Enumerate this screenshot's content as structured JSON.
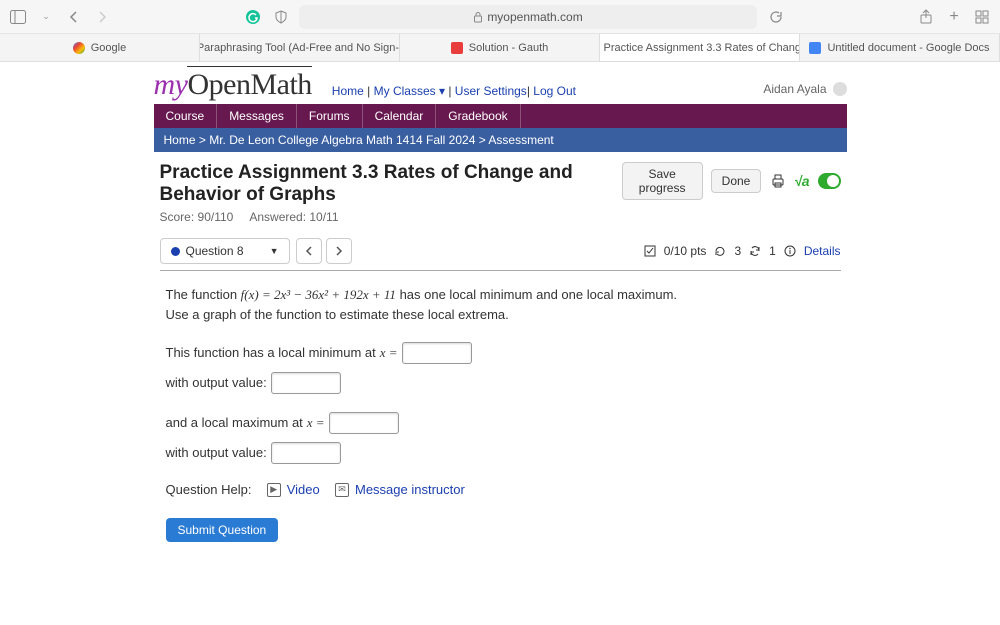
{
  "browser": {
    "url_host": "myopenmath.com",
    "tabs": [
      {
        "label": "Google",
        "favicon": "#4285f4"
      },
      {
        "label": "Paraphrasing Tool (Ad-Free and No Sign-...",
        "favicon": "#2a9d3a"
      },
      {
        "label": "Solution - Gauth",
        "favicon": "#e83e3e"
      },
      {
        "label": "Practice Assignment 3.3 Rates of Chang...",
        "favicon": "#d14",
        "active": true
      },
      {
        "label": "Untitled document - Google Docs",
        "favicon": "#4285f4"
      }
    ]
  },
  "header": {
    "logo_my": "my",
    "logo_rest": "OpenMath",
    "nav": {
      "home": "Home",
      "sep": " | ",
      "myclasses": "My Classes ▾",
      "usersettings": "User Settings",
      "logout": "Log Out"
    },
    "user": "Aidan Ayala"
  },
  "menubar": [
    "Course",
    "Messages",
    "Forums",
    "Calendar",
    "Gradebook"
  ],
  "breadcrumb": {
    "home": "Home",
    "course": "Mr. De Leon College Algebra Math 1414 Fall 2024",
    "current": "Assessment"
  },
  "assessment": {
    "title": "Practice Assignment 3.3 Rates of Change and Behavior of Graphs",
    "score_label": "Score: 90/110",
    "answered_label": "Answered: 10/11",
    "buttons": {
      "save": "Save progress",
      "done": "Done"
    }
  },
  "question": {
    "selector_label": "Question 8",
    "pts": "0/10 pts",
    "retries": "3",
    "attempts": "1",
    "details": "Details",
    "text_prefix": "The function ",
    "formula": "f(x) = 2x³ − 36x² + 192x + 11",
    "text_suffix": " has one local minimum and one local maximum.",
    "line2": "Use a graph of the function to estimate these local extrema.",
    "min_label_pre": "This function has a local minimum at ",
    "var_x_eq": "x =",
    "output_label": "with output value:",
    "max_label_pre": "and a local maximum at ",
    "help_label": "Question Help:",
    "video": "Video",
    "message": "Message instructor",
    "submit": "Submit Question"
  }
}
